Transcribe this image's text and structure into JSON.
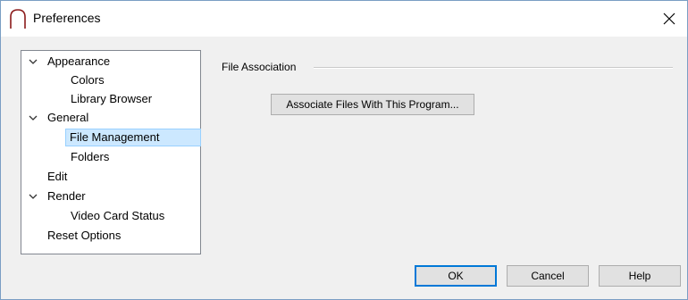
{
  "window": {
    "title": "Preferences",
    "close_glyph": "✕"
  },
  "tree": {
    "items": [
      {
        "label": "Appearance",
        "expandable": true
      },
      {
        "label": "Colors"
      },
      {
        "label": "Library Browser"
      },
      {
        "label": "General",
        "expandable": true
      },
      {
        "label": "File Management",
        "selected": true
      },
      {
        "label": "Folders"
      },
      {
        "label": "Edit"
      },
      {
        "label": "Render",
        "expandable": true
      },
      {
        "label": "Video Card Status"
      },
      {
        "label": "Reset Options"
      }
    ]
  },
  "panel": {
    "group_label": "File Association",
    "associate_button": "Associate Files With This Program..."
  },
  "footer": {
    "ok": "OK",
    "cancel": "Cancel",
    "help": "Help"
  },
  "colors": {
    "selection": "#cce8ff",
    "default_button_border": "#0078d7",
    "app_icon": "#8b1a1a"
  },
  "icons": {
    "app": "arch-icon",
    "expand": "chevron-down-icon",
    "close": "close-icon"
  }
}
